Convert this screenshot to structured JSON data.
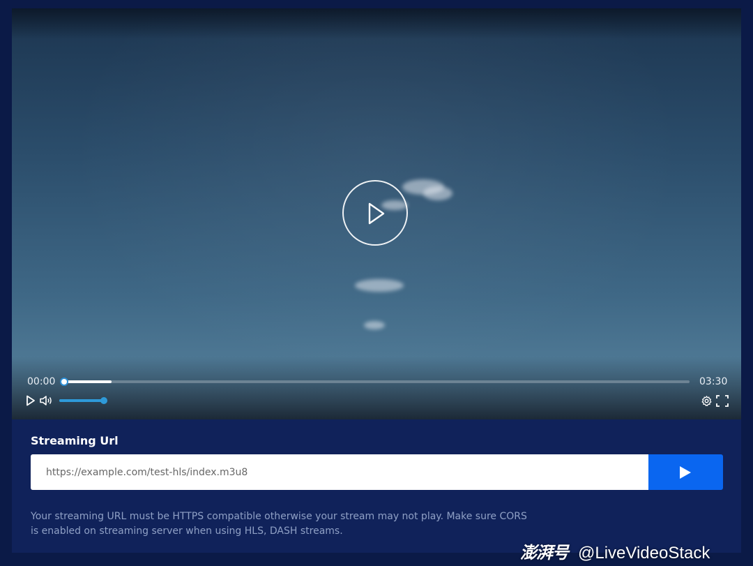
{
  "player": {
    "current_time": "00:00",
    "duration": "03:30",
    "progress_fraction": 0.0,
    "buffered_fraction": 0.076,
    "volume_fraction": 1.0,
    "accent_color": "#2e9ad9",
    "icons": {
      "big_play": "play-circle-icon",
      "play": "play-icon",
      "volume": "volume-icon",
      "settings": "gear-icon",
      "fullscreen": "fullscreen-icon"
    }
  },
  "stream": {
    "label": "Streaming Url",
    "input_value": "",
    "placeholder": "https://example.com/test-hls/index.m3u8",
    "submit_color": "#0a66f0",
    "submit_icon": "play-icon",
    "help_line1": "Your streaming URL must be HTTPS compatible otherwise your stream may not play. Make sure CORS",
    "help_line2": "is enabled on streaming server when using HLS, DASH streams."
  },
  "watermark": {
    "brand": "澎湃号",
    "handle": "@LiveVideoStack"
  }
}
